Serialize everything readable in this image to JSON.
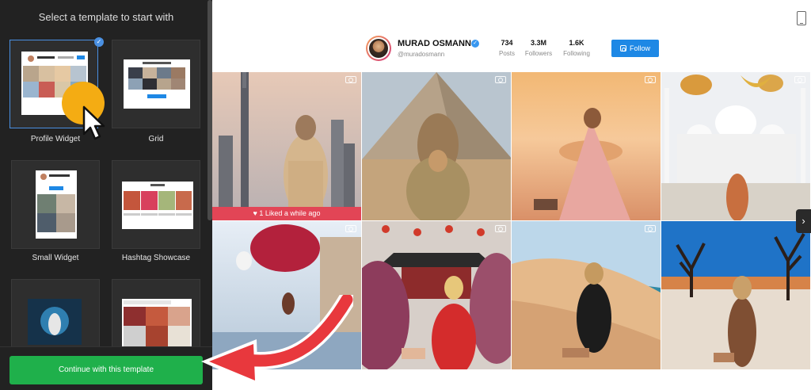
{
  "panel": {
    "title": "Select a template to start with",
    "templates": [
      {
        "label": "Profile Widget",
        "selected": true
      },
      {
        "label": "Grid",
        "selected": false
      },
      {
        "label": "Small Widget",
        "selected": false
      },
      {
        "label": "Hashtag Showcase",
        "selected": false
      },
      {
        "label": "",
        "selected": false
      },
      {
        "label": "",
        "selected": false
      }
    ],
    "continue_label": "Continue with this template",
    "check_glyph": "✓",
    "colors": {
      "panel_bg": "#222222",
      "accent": "#4a90e2",
      "continue": "#1fb04b",
      "cursor_highlight": "#f4ac13",
      "arrow": "#e8383d"
    }
  },
  "profile": {
    "name": "MURAD OSMANN",
    "handle": "@muradosmann",
    "verified_glyph": "✓",
    "stats": [
      {
        "value": "734",
        "label": "Posts"
      },
      {
        "value": "3.3M",
        "label": "Followers"
      },
      {
        "value": "1.6K",
        "label": "Following"
      }
    ],
    "follow_label": "Follow",
    "follow_color": "#1e88e5"
  },
  "feed": {
    "liked_text": "♥  1   Liked a while ago",
    "next_glyph": "›",
    "icons": {
      "post": "video-camera-icon",
      "next": "chevron-right-icon",
      "device": "mobile-phone-icon"
    }
  }
}
